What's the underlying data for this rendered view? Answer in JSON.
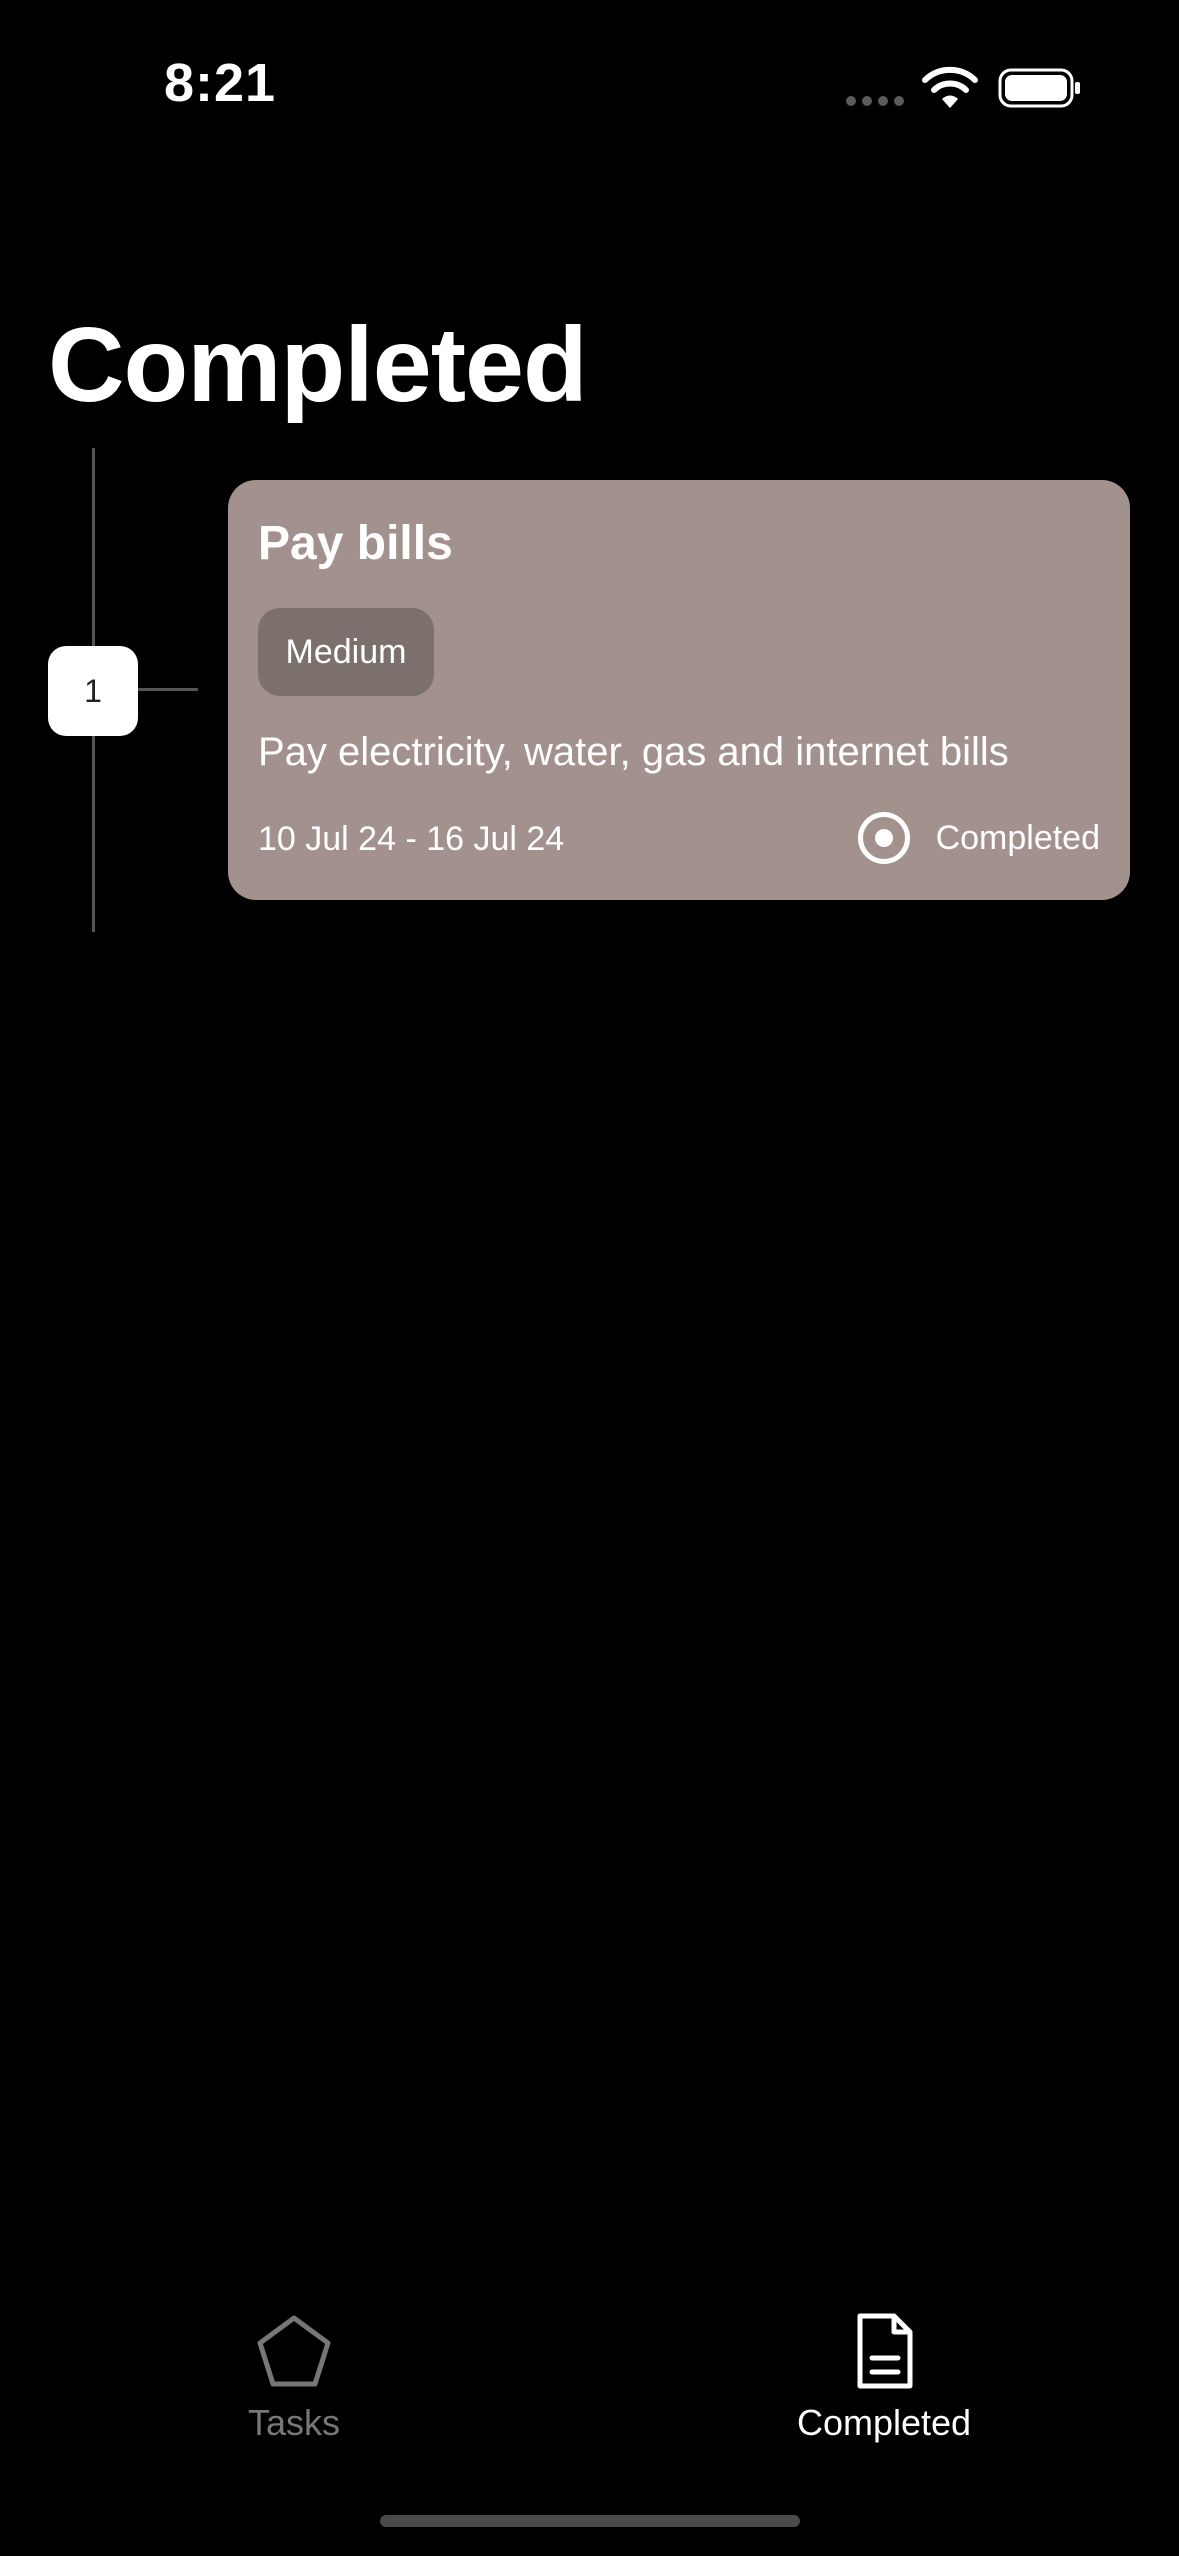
{
  "status_bar": {
    "time": "8:21",
    "icons": [
      "signal-dots-icon",
      "wifi-icon",
      "battery-icon"
    ]
  },
  "header": {
    "title": "Completed"
  },
  "timeline": {
    "node_number": "1"
  },
  "tasks": [
    {
      "title": "Pay bills",
      "priority": "Medium",
      "description": "Pay electricity, water, gas and internet bills",
      "dates": "10 Jul 24 - 16 Jul 24",
      "status": "Completed"
    }
  ],
  "tab_bar": {
    "tabs": [
      {
        "label": "Tasks",
        "icon": "pentagon-icon",
        "active": false
      },
      {
        "label": "Completed",
        "icon": "document-icon",
        "active": true
      }
    ]
  },
  "colors": {
    "background": "#000000",
    "card": "#a2918c",
    "badge": "#7c706d",
    "inactive_tab": "#777777",
    "active_tab": "#ffffff"
  }
}
